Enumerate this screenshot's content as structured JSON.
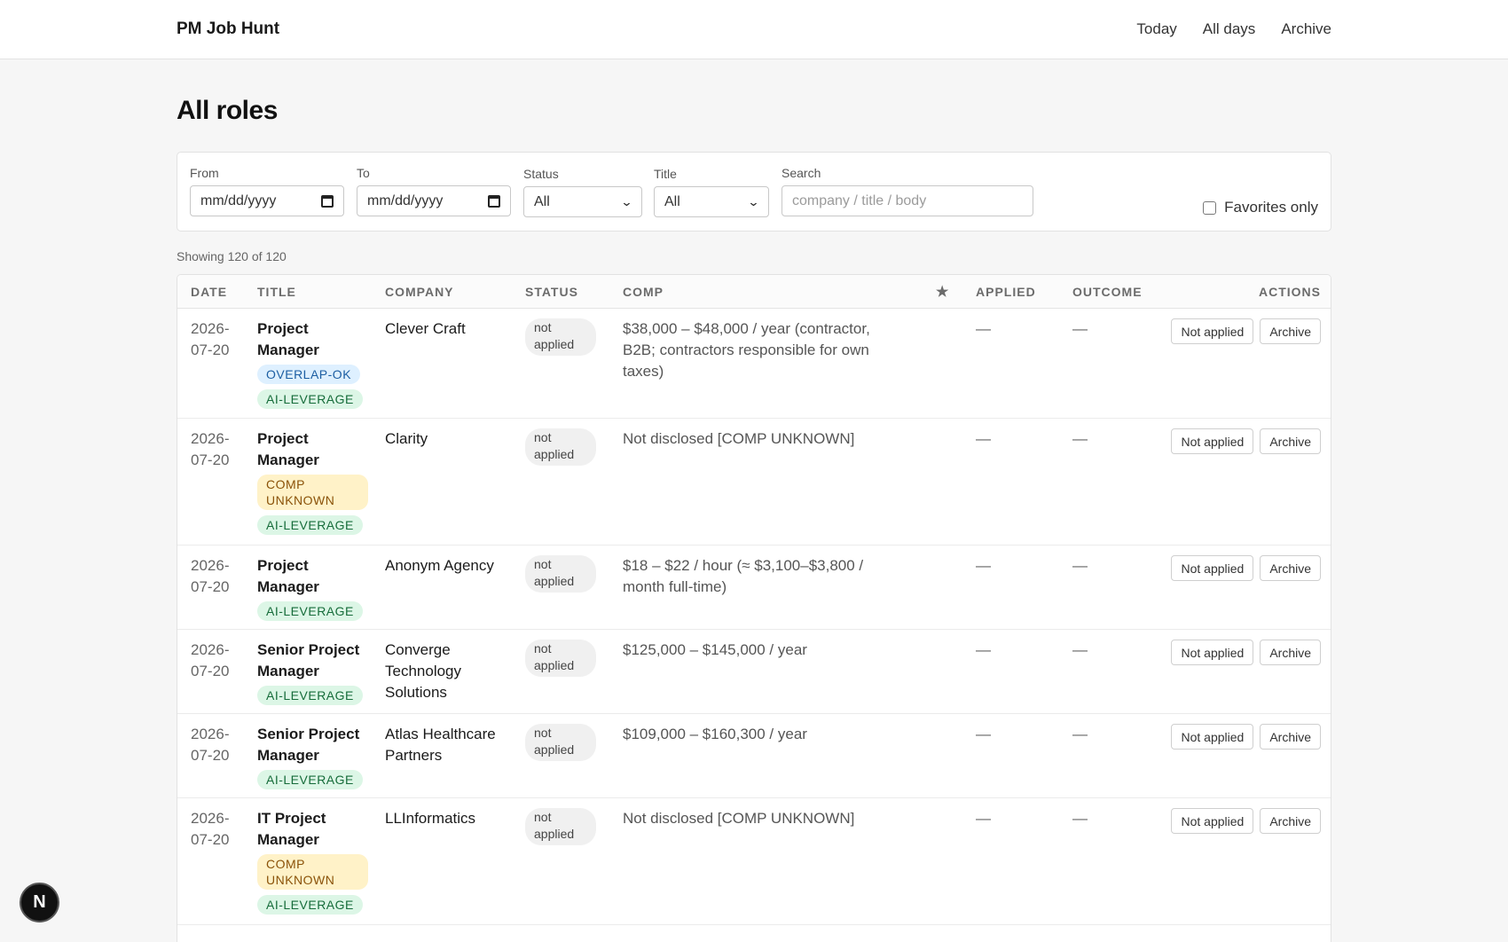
{
  "header": {
    "brand": "PM Job Hunt",
    "nav": [
      "Today",
      "All days",
      "Archive"
    ]
  },
  "page": {
    "title": "All roles"
  },
  "filters": {
    "from_label": "From",
    "from_placeholder": "mm/dd/yyyy",
    "to_label": "To",
    "to_placeholder": "mm/dd/yyyy",
    "status_label": "Status",
    "status_value": "All",
    "title_label": "Title",
    "title_value": "All",
    "search_label": "Search",
    "search_placeholder": "company / title / body",
    "favorites_label": "Favorites only"
  },
  "summary": {
    "showing": "Showing 120 of 120"
  },
  "table": {
    "columns": [
      "Date",
      "Title",
      "Company",
      "Status",
      "Comp",
      "★",
      "Applied",
      "Outcome",
      "Actions"
    ],
    "rows": [
      {
        "date": "2026-07-20",
        "title": "Project Manager",
        "tags": [
          {
            "label": "OVERLAP-OK",
            "kind": "ov"
          },
          {
            "label": "AI-LEVERAGE",
            "kind": "ai"
          }
        ],
        "company": "Clever Craft",
        "status": "not applied",
        "comp": "$38,000 – $48,000 / year (contractor, B2B; contractors responsible for own taxes)",
        "applied": "—",
        "outcome": "—",
        "action_primary": "Not applied",
        "action_secondary": "Archive"
      },
      {
        "date": "2026-07-20",
        "title": "Project Manager",
        "tags": [
          {
            "label": "COMP UNKNOWN",
            "kind": "cu"
          },
          {
            "label": "AI-LEVERAGE",
            "kind": "ai"
          }
        ],
        "company": "Clarity",
        "status": "not applied",
        "comp": "Not disclosed [COMP UNKNOWN]",
        "applied": "—",
        "outcome": "—",
        "action_primary": "Not applied",
        "action_secondary": "Archive"
      },
      {
        "date": "2026-07-20",
        "title": "Project Manager",
        "tags": [
          {
            "label": "AI-LEVERAGE",
            "kind": "ai"
          }
        ],
        "company": "Anonym Agency",
        "status": "not applied",
        "comp": "$18 – $22 / hour (≈ $3,100–$3,800 / month full-time)",
        "applied": "—",
        "outcome": "—",
        "action_primary": "Not applied",
        "action_secondary": "Archive"
      },
      {
        "date": "2026-07-20",
        "title": "Senior Project Manager",
        "tags": [
          {
            "label": "AI-LEVERAGE",
            "kind": "ai"
          }
        ],
        "company": "Converge Technology Solutions",
        "status": "not applied",
        "comp": "$125,000 – $145,000 / year",
        "applied": "—",
        "outcome": "—",
        "action_primary": "Not applied",
        "action_secondary": "Archive"
      },
      {
        "date": "2026-07-20",
        "title": "Senior Project Manager",
        "tags": [
          {
            "label": "AI-LEVERAGE",
            "kind": "ai"
          }
        ],
        "company": "Atlas Healthcare Partners",
        "status": "not applied",
        "comp": "$109,000 – $160,300 / year",
        "applied": "—",
        "outcome": "—",
        "action_primary": "Not applied",
        "action_secondary": "Archive"
      },
      {
        "date": "2026-07-20",
        "title": "IT Project Manager",
        "tags": [
          {
            "label": "COMP UNKNOWN",
            "kind": "cu"
          },
          {
            "label": "AI-LEVERAGE",
            "kind": "ai"
          }
        ],
        "company": "LLInformatics",
        "status": "not applied",
        "comp": "Not disclosed [COMP UNKNOWN]",
        "applied": "—",
        "outcome": "—",
        "action_primary": "Not applied",
        "action_secondary": "Archive"
      }
    ]
  },
  "fab": {
    "label": "N"
  }
}
